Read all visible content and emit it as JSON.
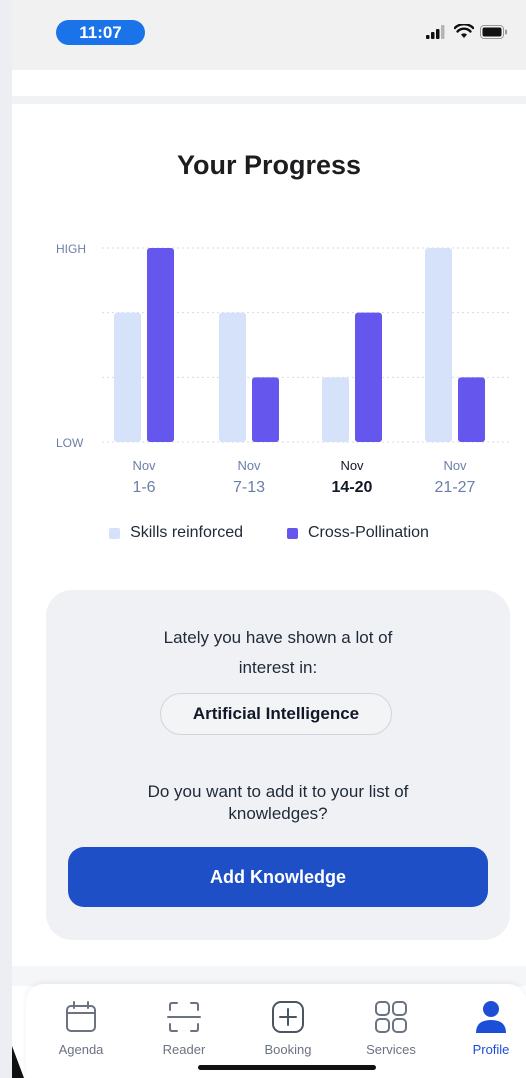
{
  "status_bar": {
    "time": "11:07"
  },
  "page": {
    "title": "Your Progress"
  },
  "chart_data": {
    "type": "bar",
    "categories": [
      {
        "month": "Nov",
        "range": "1-6"
      },
      {
        "month": "Nov",
        "range": "7-13"
      },
      {
        "month": "Nov",
        "range": "14-20"
      },
      {
        "month": "Nov",
        "range": "21-27"
      }
    ],
    "selected_category_index": 2,
    "y_axis": {
      "top_label": "HIGH",
      "bottom_label": "LOW",
      "levels": 3
    },
    "series": [
      {
        "name": "Skills reinforced",
        "values": [
          2,
          2,
          1,
          3
        ],
        "color": "#d6e2fa"
      },
      {
        "name": "Cross-Pollination",
        "values": [
          3,
          1,
          2,
          1
        ],
        "color": "#6557ee"
      }
    ],
    "grid": true,
    "legend_position": "bottom"
  },
  "suggestion": {
    "line1": "Lately you have shown a lot of",
    "line2": "interest in:",
    "topic": "Artificial Intelligence",
    "question_line1": "Do you want to add it to your list of",
    "question_line2": "knowledges?",
    "button_label": "Add Knowledge"
  },
  "tab_bar": {
    "tabs": [
      {
        "label": "Agenda",
        "icon": "calendar-icon",
        "active": false
      },
      {
        "label": "Reader",
        "icon": "scan-icon",
        "active": false
      },
      {
        "label": "Booking",
        "icon": "plus-square-icon",
        "active": false
      },
      {
        "label": "Services",
        "icon": "grid-icon",
        "active": false
      },
      {
        "label": "Profile",
        "icon": "person-icon",
        "active": true
      }
    ]
  },
  "colors": {
    "accent": "#1e4fc7",
    "active_tab": "#1d4ed8",
    "time_pill": "#1a73e8"
  }
}
